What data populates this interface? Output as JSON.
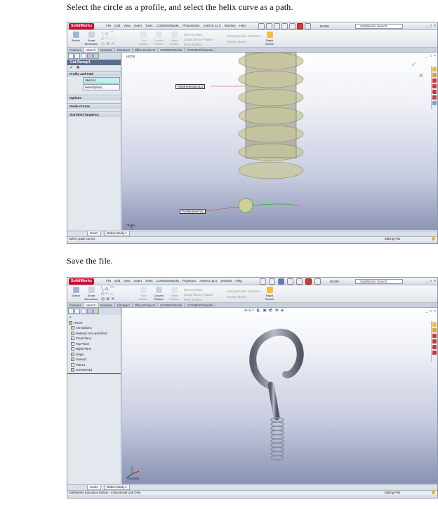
{
  "captions": {
    "step1": "Select the circle as a profile, and select the helix curve as a path.",
    "step2": "Save the file."
  },
  "app": {
    "logo": "SolidWorks",
    "menu": [
      "File",
      "Edit",
      "View",
      "Insert",
      "Tools",
      "COSMOSWorks",
      "PhotoWorks",
      "ANSYS 11.0",
      "Window",
      "Help"
    ],
    "menu2": [
      "File",
      "Edit",
      "View",
      "Insert",
      "Tools",
      "COSMOSWorks",
      "Playerpro",
      "ANSYS 11.0",
      "Window",
      "Help"
    ],
    "doc_title": "HOOK",
    "search_placeholder": "SolidWorks Search",
    "window_buttons": [
      "_",
      "□",
      "×"
    ],
    "rapid_search": "Rapid Search",
    "ribbon": {
      "sketch": "Sketch",
      "smart_dimension": "Smart Dimension",
      "trim": "Trim Entities",
      "convert": "Convert Entities",
      "offset": "Offset Entities",
      "mirror": "Mirror Entities",
      "linear_pattern": "Linear Sketch Pattern",
      "move": "Move Entities",
      "display_delete": "Display/Delete Relations",
      "repair": "Repair Sketch"
    },
    "command_tabs": [
      "Features",
      "Sketch",
      "Evaluate",
      "DimXpert",
      "Office Products",
      "COSMOSWorks",
      "COSMOSFloWorks"
    ],
    "bottom_tabs": [
      "Model",
      "Motion Study 1"
    ]
  },
  "shot1": {
    "pm_title": "Cut-Sweep1",
    "groups": [
      "Profile and Path",
      "Options",
      "Guide Curves",
      "Start/End Tangency"
    ],
    "profile_sel": "Sketch4",
    "path_sel": "Helix/Spiral1",
    "tree_root": "HOOK",
    "callout_path": "Path(Helix/Spiral1)",
    "callout_profile": "Profile(Sketch4)",
    "view_label": "*Right",
    "status_left": "Select guide curves",
    "status_right": "Editing Part"
  },
  "shot2": {
    "tree_root": "HOOK",
    "tree_items": [
      "Annotations",
      "Material <not specified>",
      "Front Plane",
      "Top Plane",
      "Right Plane",
      "Origin",
      "Sweep2",
      "Plane1",
      "Cut-Sweep1"
    ],
    "view_label": "*Trimetric",
    "status_left": "SolidWorks Education Edition - Instructional Use Only",
    "status_right": "Editing Part"
  }
}
